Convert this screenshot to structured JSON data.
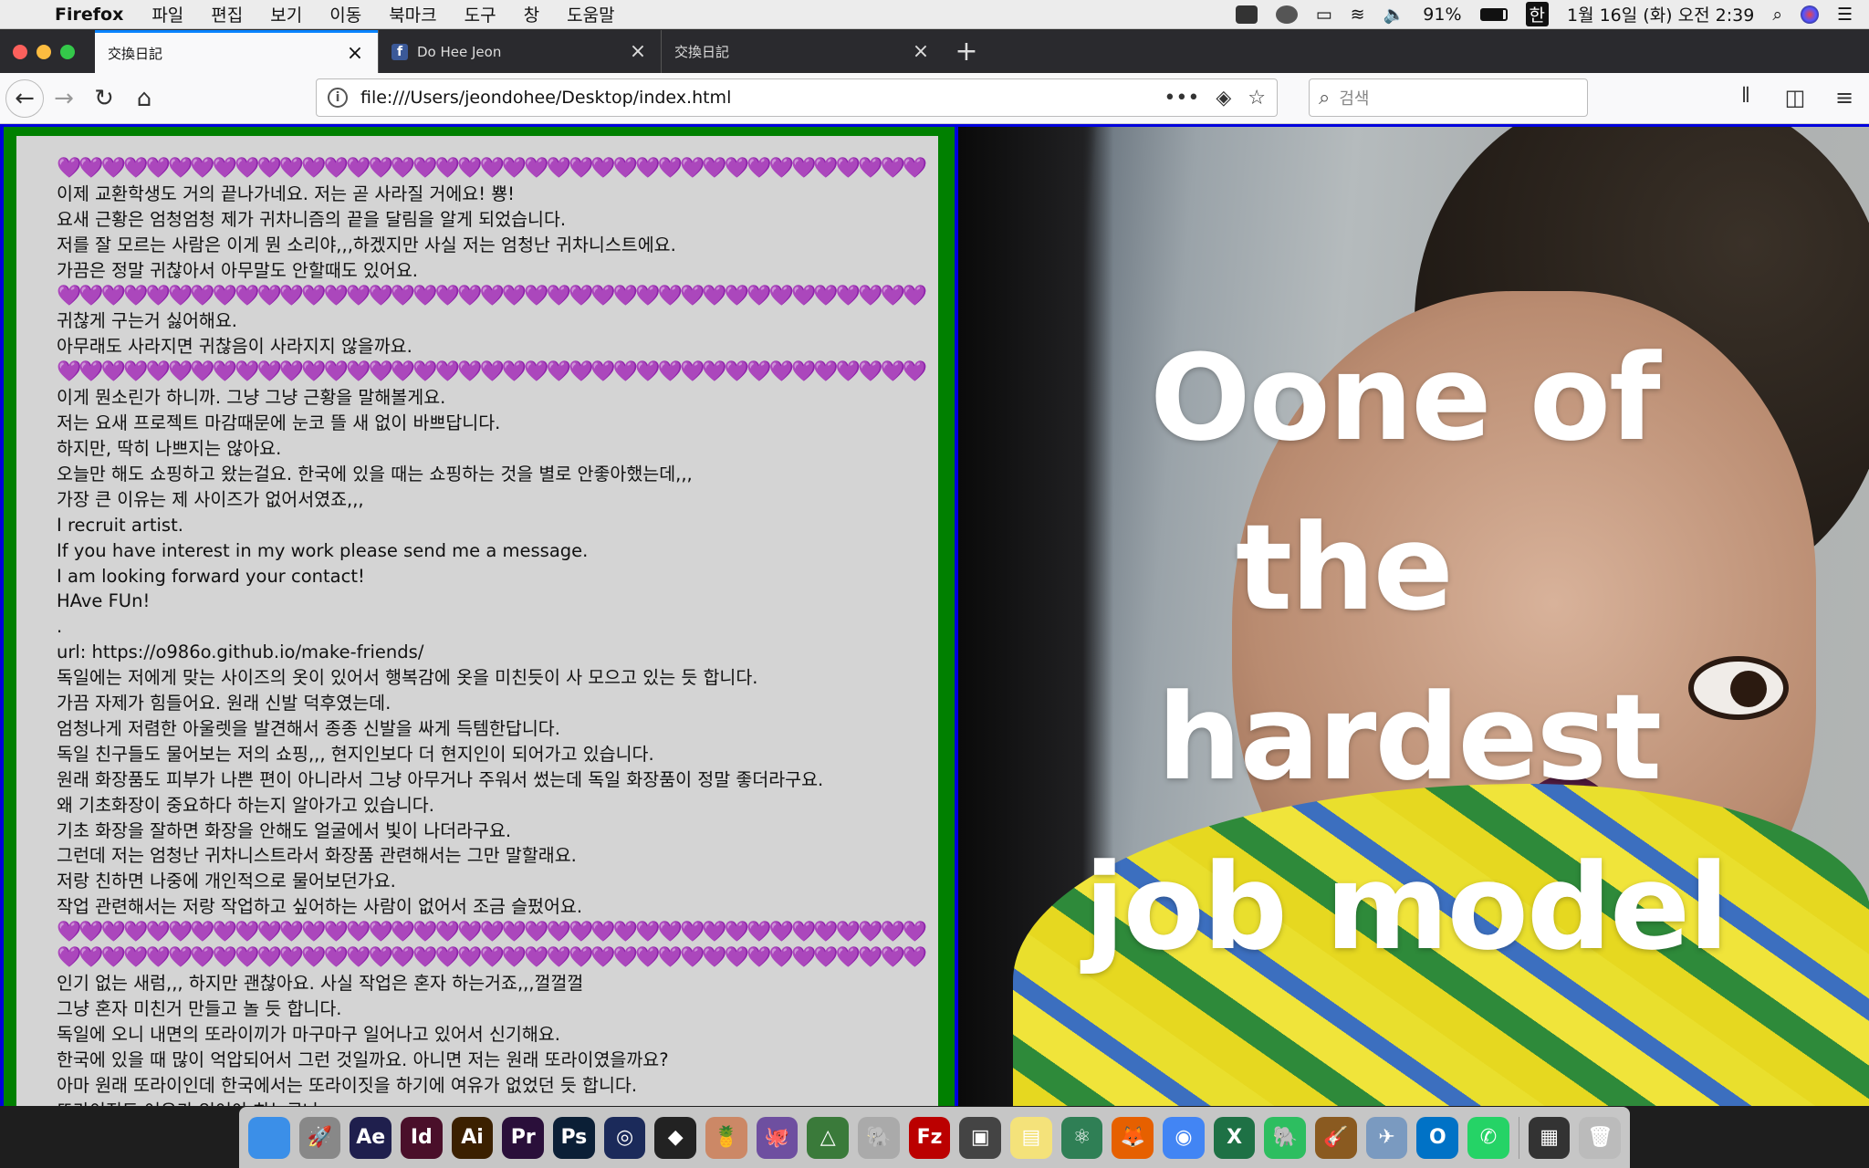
{
  "menubar": {
    "apple_icon": "apple-icon",
    "app_name": "Firefox",
    "menus": [
      "파일",
      "편집",
      "보기",
      "이동",
      "북마크",
      "도구",
      "창",
      "도움말"
    ],
    "battery": "91%",
    "input_method": "한",
    "datetime": "1월 16일 (화) 오전 2:39"
  },
  "tabs": [
    {
      "label": "交換日記",
      "active": true
    },
    {
      "label": "Do Hee Jeon",
      "active": false,
      "favicon": "f"
    },
    {
      "label": "交換日記",
      "active": false
    }
  ],
  "navbar": {
    "url": "file:///Users/jeondohee/Desktop/index.html",
    "search_placeholder": "검색"
  },
  "content": {
    "hearts": "💜💜💜💜💜💜💜💜💜💜💜💜💜💜💜💜💜💜💜💜💜💜💜💜💜💜💜💜💜💜💜💜💜💜💜💜💜💜💜",
    "lines": [
      {
        "type": "hearts"
      },
      {
        "type": "text",
        "text": "이제 교환학생도 거의 끝나가네요. 저는 곧 사라질 거에요! 뿅!"
      },
      {
        "type": "text",
        "text": "요새 근황은 엄청엄청 제가 귀차니즘의 끝을 달림을 알게 되었습니다."
      },
      {
        "type": "text",
        "text": "저를 잘 모르는 사람은 이게 뭔 소리야,,,하겠지만 사실 저는 엄청난 귀차니스트에요."
      },
      {
        "type": "text",
        "text": "가끔은 정말 귀찮아서 아무말도 안할때도 있어요."
      },
      {
        "type": "hearts"
      },
      {
        "type": "text",
        "text": "귀찮게 구는거 싫어해요."
      },
      {
        "type": "text",
        "text": "아무래도 사라지면 귀찮음이 사라지지 않을까요."
      },
      {
        "type": "hearts"
      },
      {
        "type": "text",
        "text": "이게 뭔소린가 하니까. 그냥 그냥 근황을 말해볼게요."
      },
      {
        "type": "text",
        "text": "저는 요새 프로젝트 마감때문에 눈코 뜰 새 없이 바쁘답니다."
      },
      {
        "type": "text",
        "text": "하지만, 딱히 나쁘지는 않아요."
      },
      {
        "type": "text",
        "text": "오늘만 해도 쇼핑하고 왔는걸요. 한국에 있을 때는 쇼핑하는 것을 별로 안좋아했는데,,,"
      },
      {
        "type": "text",
        "text": "가장 큰 이유는 제 사이즈가 없어서였죠,,,"
      },
      {
        "type": "text",
        "text": "I recruit artist."
      },
      {
        "type": "text",
        "text": "If you have interest in my work please send me a message."
      },
      {
        "type": "text",
        "text": "I am looking forward your contact!"
      },
      {
        "type": "text",
        "text": "HAve FUn!"
      },
      {
        "type": "text",
        "text": "."
      },
      {
        "type": "text",
        "text": "url: https://o986o.github.io/make-friends/"
      },
      {
        "type": "text",
        "text": "독일에는 저에게 맞는 사이즈의 옷이 있어서 행복감에 옷을 미친듯이 사 모으고 있는 듯 합니다."
      },
      {
        "type": "text",
        "text": "가끔 자제가 힘들어요. 원래 신발 덕후였는데."
      },
      {
        "type": "text",
        "text": "엄청나게 저렴한 아울렛을 발견해서 종종 신발을 싸게 득템한답니다."
      },
      {
        "type": "text",
        "text": "독일 친구들도 물어보는 저의 쇼핑,,, 현지인보다 더 현지인이 되어가고 있습니다."
      },
      {
        "type": "text",
        "text": "원래 화장품도 피부가 나쁜 편이 아니라서 그냥 아무거나 주워서 썼는데 독일 화장품이 정말 좋더라구요."
      },
      {
        "type": "text",
        "text": "왜 기초화장이 중요하다 하는지 알아가고 있습니다."
      },
      {
        "type": "text",
        "text": "기초 화장을 잘하면 화장을 안해도 얼굴에서 빛이 나더라구요."
      },
      {
        "type": "text",
        "text": "그런데 저는 엄청난 귀차니스트라서 화장품 관련해서는 그만 말할래요."
      },
      {
        "type": "text",
        "text": "저랑 친하면 나중에 개인적으로 물어보던가요."
      },
      {
        "type": "text",
        "text": "작업 관련해서는 저랑 작업하고 싶어하는 사람이 없어서 조금 슬펐어요."
      },
      {
        "type": "hearts"
      },
      {
        "type": "hearts"
      },
      {
        "type": "text",
        "text": "인기 없는 새럼,,, 하지만 괜찮아요. 사실 작업은 혼자 하는거죠,,,껄껄껄"
      },
      {
        "type": "text",
        "text": "그냥 혼자 미친거 만들고 놀 듯 합니다."
      },
      {
        "type": "text",
        "text": "독일에 오니 내면의 또라이끼가 마구마구 일어나고 있어서 신기해요."
      },
      {
        "type": "text",
        "text": "한국에 있을 때 많이 억압되어서 그런 것일까요. 아니면 저는 원래 또라이였을까요?"
      },
      {
        "type": "text",
        "text": "아마 원래 또라이인데 한국에서는 또라이짓을 하기에 여유가 없었던 듯 합니다."
      },
      {
        "type": "text",
        "text": "또라이짓도 여유가 있어야 하는군나"
      }
    ]
  },
  "video_overlay": {
    "line1": "Oone of",
    "line2": "the",
    "line3": "hardest",
    "line4": "job model"
  },
  "dock": {
    "icons": [
      "finder",
      "launchpad",
      "Ae",
      "Id",
      "Ai",
      "Pr",
      "Ps",
      "cinema4d",
      "unity",
      "cocktail",
      "github",
      "android-studio",
      "sequel-pro",
      "filezilla",
      "processing",
      "notes",
      "atom",
      "firefox",
      "chrome",
      "excel",
      "evernote",
      "garageband",
      "preview",
      "outlook",
      "whatsapp",
      "recent-doc",
      "trash"
    ]
  },
  "colors": {
    "left_bg": "#008000",
    "text_box_bg": "#d4d4d4",
    "border": "#0000dd",
    "heart": "#a020f0"
  }
}
